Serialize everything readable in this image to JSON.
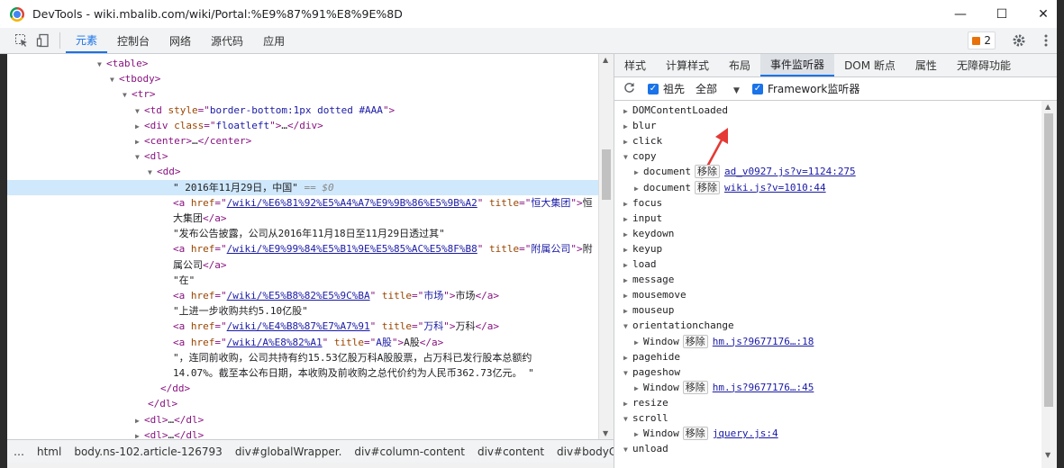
{
  "window": {
    "title": "DevTools - wiki.mbalib.com/wiki/Portal:%E9%87%91%E8%9E%8D",
    "minimize": "—",
    "maximize": "☐",
    "close": "✕"
  },
  "toolbar": {
    "tabs": [
      "元素",
      "控制台",
      "网络",
      "源代码",
      "应用"
    ],
    "active_tab": "元素",
    "issues_count": "2"
  },
  "elements": {
    "lines": [
      {
        "indent": 108,
        "tri": "▼",
        "html": "<span class='tag'>&lt;table&gt;</span>"
      },
      {
        "indent": 122,
        "tri": "▼",
        "html": "<span class='tag'>&lt;tbody&gt;</span>"
      },
      {
        "indent": 136,
        "tri": "▼",
        "html": "<span class='tag'>&lt;tr&gt;</span>"
      },
      {
        "indent": 150,
        "tri": "▼",
        "html": "<span class='tag'>&lt;td </span><span class='attr'>style</span><span class='tag'>=\"</span><span class='val'>border-bottom:1px dotted #AAA</span><span class='tag'>\"&gt;</span>"
      },
      {
        "indent": 150,
        "tri": "▶",
        "pad": 14,
        "html": "<span class='tag'>&lt;div </span><span class='attr'>class</span><span class='tag'>=\"</span><span class='val'>floatleft</span><span class='tag'>\"&gt;</span>…<span class='tag'>&lt;/div&gt;</span>"
      },
      {
        "indent": 150,
        "tri": "▶",
        "pad": 14,
        "html": "<span class='tag'>&lt;center&gt;</span>…<span class='tag'>&lt;/center&gt;</span>"
      },
      {
        "indent": 150,
        "tri": "▼",
        "pad": 14,
        "html": "<span class='tag'>&lt;dl&gt;</span>"
      },
      {
        "indent": 164,
        "tri": "▼",
        "pad": 14,
        "html": "<span class='tag'>&lt;dd&gt;</span>"
      },
      {
        "indent": 182,
        "tri": "",
        "sel": true,
        "html": "<span class='txt'>\" 2016年11月29日，中国\"</span> <span class='eq'>== $0</span>"
      },
      {
        "indent": 182,
        "tri": "",
        "html": "<span class='tag'>&lt;a </span><span class='attr'>href</span><span class='tag'>=\"</span><span class='link'>/wiki/%E6%81%92%E5%A4%A7%E9%9B%86%E5%9B%A2</span><span class='tag'>\" </span><span class='attr'>title</span><span class='tag'>=\"</span><span class='val'>恒大集团</span><span class='tag'>\"&gt;</span><span class='txt'>恒</span>"
      },
      {
        "indent": 182,
        "tri": "",
        "html": "<span class='txt'>大集团</span><span class='tag'>&lt;/a&gt;</span>"
      },
      {
        "indent": 182,
        "tri": "",
        "html": "<span class='txt'>\"发布公告披露，公司从2016年11月18日至11月29日透过其\"</span>"
      },
      {
        "indent": 182,
        "tri": "",
        "html": "<span class='tag'>&lt;a </span><span class='attr'>href</span><span class='tag'>=\"</span><span class='link'>/wiki/%E9%99%84%E5%B1%9E%E5%85%AC%E5%8F%B8</span><span class='tag'>\" </span><span class='attr'>title</span><span class='tag'>=\"</span><span class='val'>附属公司</span><span class='tag'>\"&gt;</span><span class='txt'>附</span>"
      },
      {
        "indent": 182,
        "tri": "",
        "html": "<span class='txt'>属公司</span><span class='tag'>&lt;/a&gt;</span>"
      },
      {
        "indent": 182,
        "tri": "",
        "html": "<span class='txt'>\"在\"</span>"
      },
      {
        "indent": 182,
        "tri": "",
        "html": "<span class='tag'>&lt;a </span><span class='attr'>href</span><span class='tag'>=\"</span><span class='link'>/wiki/%E5%B8%82%E5%9C%BA</span><span class='tag'>\" </span><span class='attr'>title</span><span class='tag'>=\"</span><span class='val'>市场</span><span class='tag'>\"&gt;</span><span class='txt'>市场</span><span class='tag'>&lt;/a&gt;</span>"
      },
      {
        "indent": 182,
        "tri": "",
        "html": "<span class='txt'>\"上进一步收购共约5.10亿股\"</span>"
      },
      {
        "indent": 182,
        "tri": "",
        "html": "<span class='tag'>&lt;a </span><span class='attr'>href</span><span class='tag'>=\"</span><span class='link'>/wiki/%E4%B8%87%E7%A7%91</span><span class='tag'>\" </span><span class='attr'>title</span><span class='tag'>=\"</span><span class='val'>万科</span><span class='tag'>\"&gt;</span><span class='txt'>万科</span><span class='tag'>&lt;/a&gt;</span>"
      },
      {
        "indent": 182,
        "tri": "",
        "html": "<span class='tag'>&lt;a </span><span class='attr'>href</span><span class='tag'>=\"</span><span class='link'>/wiki/A%E8%82%A1</span><span class='tag'>\" </span><span class='attr'>title</span><span class='tag'>=\"</span><span class='val'>A股</span><span class='tag'>\"&gt;</span><span class='txt'>A股</span><span class='tag'>&lt;/a&gt;</span>"
      },
      {
        "indent": 182,
        "tri": "",
        "html": "<span class='txt'>\"，连同前收购，公司共持有约15.53亿股万科A股股票，占万科已发行股本总额约</span>"
      },
      {
        "indent": 182,
        "tri": "",
        "html": "<span class='txt'>14.07%。截至本公布日期，本收购及前收购之总代价约为人民币362.73亿元。 \"</span>"
      },
      {
        "indent": 168,
        "tri": "",
        "html": "<span class='tag'>&lt;/dd&gt;</span>"
      },
      {
        "indent": 154,
        "tri": "",
        "html": "<span class='tag'>&lt;/dl&gt;</span>"
      },
      {
        "indent": 150,
        "tri": "▶",
        "pad": 0,
        "html": "<span class='tag'>&lt;dl&gt;</span>…<span class='tag'>&lt;/dl&gt;</span>"
      },
      {
        "indent": 150,
        "tri": "▶",
        "pad": 0,
        "html": "<span class='tag'>&lt;dl&gt;</span>…<span class='tag'>&lt;/dl&gt;</span>"
      }
    ]
  },
  "breadcrumbs": [
    "…",
    "html",
    "body.ns-102.article-126793",
    "div#globalWrapper.",
    "div#column-content",
    "div#content",
    "div#bodyContent"
  ],
  "right_tabs": [
    "样式",
    "计算样式",
    "布局",
    "事件监听器",
    "DOM 断点",
    "属性",
    "无障碍功能"
  ],
  "right_active": "事件监听器",
  "listener_toolbar": {
    "ancestors_label": "祖先",
    "filter_label": "全部",
    "framework_label": "Framework监听器"
  },
  "remove_label": "移除",
  "events": [
    {
      "name": "DOMContentLoaded",
      "open": false
    },
    {
      "name": "blur",
      "open": false
    },
    {
      "name": "click",
      "open": false
    },
    {
      "name": "copy",
      "open": true,
      "children": [
        {
          "target": "document",
          "src": "ad_v0927.js?v=1124:275"
        },
        {
          "target": "document",
          "src": "wiki.js?v=1010:44"
        }
      ]
    },
    {
      "name": "focus",
      "open": false
    },
    {
      "name": "input",
      "open": false
    },
    {
      "name": "keydown",
      "open": false
    },
    {
      "name": "keyup",
      "open": false
    },
    {
      "name": "load",
      "open": false
    },
    {
      "name": "message",
      "open": false
    },
    {
      "name": "mousemove",
      "open": false
    },
    {
      "name": "mouseup",
      "open": false
    },
    {
      "name": "orientationchange",
      "open": true,
      "children": [
        {
          "target": "Window",
          "src": "hm.js?9677176…:18"
        }
      ]
    },
    {
      "name": "pagehide",
      "open": false
    },
    {
      "name": "pageshow",
      "open": true,
      "children": [
        {
          "target": "Window",
          "src": "hm.js?9677176…:45"
        }
      ]
    },
    {
      "name": "resize",
      "open": false
    },
    {
      "name": "scroll",
      "open": true,
      "children": [
        {
          "target": "Window",
          "src": "jquery.js:4"
        }
      ]
    },
    {
      "name": "unload",
      "open": true
    }
  ]
}
